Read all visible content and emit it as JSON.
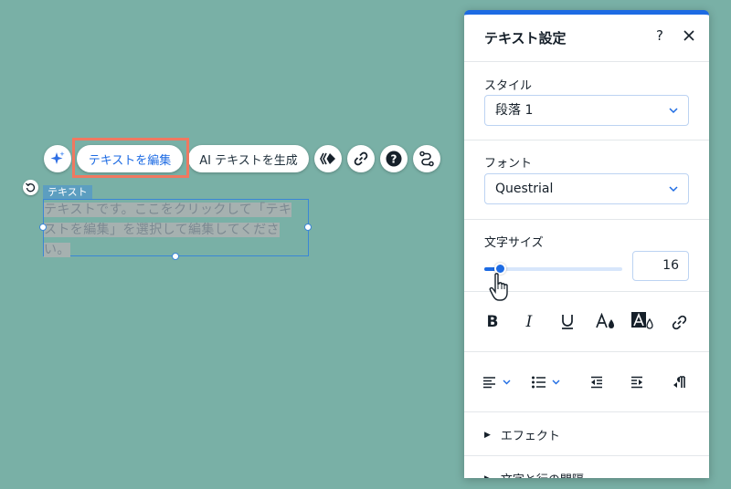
{
  "toolbar": {
    "edit_text_label": "テキストを編集",
    "ai_text_label": "AI テキストを生成"
  },
  "canvas": {
    "element_tag": "テキスト",
    "paragraph_line1": "テキストです。ここをクリックして「テキ",
    "paragraph_line2": "ストを編集」を選択して編集してくださ",
    "paragraph_line3": "い。"
  },
  "panel": {
    "title": "テキスト設定",
    "help_label": "?",
    "style": {
      "label": "スタイル",
      "selected": "段落 1"
    },
    "font": {
      "label": "フォント",
      "selected": "Questrial"
    },
    "font_size": {
      "label": "文字サイズ",
      "value": "16",
      "slider_fraction": 0.12
    },
    "sections": [
      {
        "label": "エフェクト"
      },
      {
        "label": "文字と行の間隔"
      }
    ]
  },
  "colors": {
    "canvas_bg": "#79b0a6",
    "accent": "#1d6be3",
    "highlight": "#f07860"
  }
}
